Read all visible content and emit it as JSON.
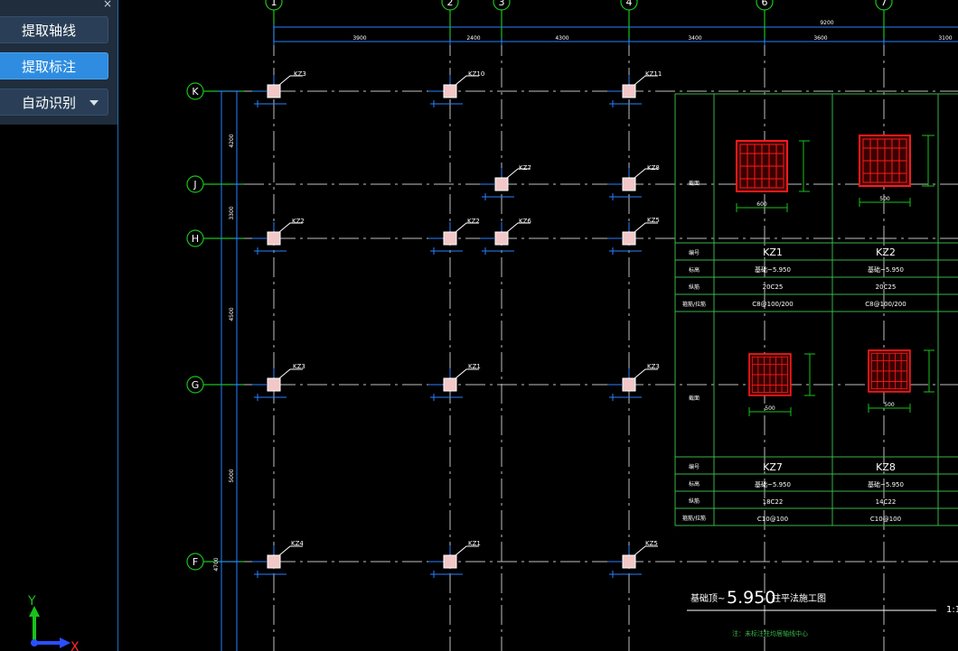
{
  "panel": {
    "close_glyph": "×",
    "buttons": [
      {
        "label": "提取轴线",
        "active": false
      },
      {
        "label": "提取标注",
        "active": true
      },
      {
        "label": "自动识别",
        "active": false,
        "has_dropdown": true
      }
    ]
  },
  "ucs": {
    "y_label": "Y",
    "x_label": "X"
  },
  "drawing": {
    "column_axes": [
      "1",
      "2",
      "3",
      "4",
      "6",
      "7"
    ],
    "row_axes": [
      "K",
      "J",
      "H",
      "G",
      "F"
    ],
    "top_dimension_total": "9200",
    "top_dimensions": [
      "3900",
      "2400",
      "4300",
      "3400",
      "3600",
      "3100"
    ],
    "left_dimensions": [
      "4200",
      "3300",
      "4500",
      "5000",
      "4700"
    ],
    "column_tags": [
      {
        "id": "k1",
        "text": "KZ3"
      },
      {
        "id": "k2",
        "text": "KZ10"
      },
      {
        "id": "k3",
        "text": "KZ11"
      },
      {
        "id": "j1",
        "text": "KZ7"
      },
      {
        "id": "j2",
        "text": "KZ8"
      },
      {
        "id": "h1",
        "text": "KZ2"
      },
      {
        "id": "h2",
        "text": "KZ2"
      },
      {
        "id": "h3",
        "text": "KZ6"
      },
      {
        "id": "h4",
        "text": "KZ5"
      },
      {
        "id": "g1",
        "text": "KZ3"
      },
      {
        "id": "g2",
        "text": "KZ1"
      },
      {
        "id": "g3",
        "text": "KZ3"
      },
      {
        "id": "f1",
        "text": "KZ4"
      },
      {
        "id": "f2",
        "text": "KZ1"
      },
      {
        "id": "f3",
        "text": "KZ5"
      }
    ],
    "table": {
      "row_labels_top": [
        "截面",
        "编号",
        "标高",
        "纵筋",
        "箍筋/拉筋"
      ],
      "row_labels_bottom": [
        "截面",
        "编号",
        "标高",
        "纵筋",
        "箍筋/拉筋"
      ],
      "section_dims": [
        "600",
        "500",
        "500",
        "500"
      ],
      "columns_top": [
        {
          "name": "KZ1",
          "elev": "基础~5.950",
          "bars": "20C25",
          "stirrup": "C8@100/200"
        },
        {
          "name": "KZ2",
          "elev": "基础~5.950",
          "bars": "20C25",
          "stirrup": "C8@100/200"
        }
      ],
      "columns_bottom": [
        {
          "name": "KZ7",
          "elev": "基础~5.950",
          "bars": "18C22",
          "stirrup": "C10@100"
        },
        {
          "name": "KZ8",
          "elev": "基础~5.950",
          "bars": "14C22",
          "stirrup": "C10@100"
        }
      ]
    },
    "title_prefix": "基础顶~",
    "title_number": "5.950",
    "title_suffix": "柱平法施工图",
    "scale": "1:1",
    "note": "注：未标注柱均居轴线中心"
  },
  "colors": {
    "axis_green": "#19c219",
    "dim_blue": "#2a7fff",
    "grid_gray": "#bfbfbf",
    "tag_white": "#ffffff",
    "table_green": "#39b54a",
    "column_fill": "#f2c7c7",
    "rebar_red": "#ff1a1a",
    "panel_bg": "#1f2d3d",
    "button_active": "#2e8de1"
  }
}
